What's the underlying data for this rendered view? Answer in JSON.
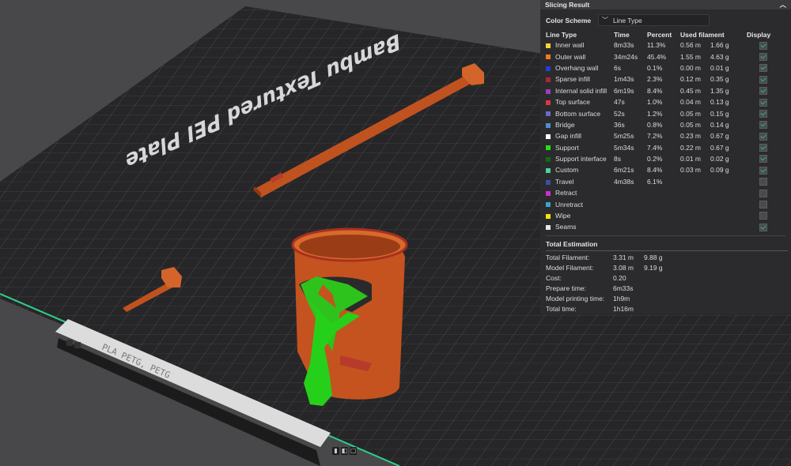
{
  "plate": {
    "name": "Bambu Textured PEI Plate",
    "filament_label": "PLA PETG, PETG"
  },
  "panel": {
    "title": "Slicing Result",
    "collapse_icon": "chevron-up-icon",
    "color_scheme_label": "Color Scheme",
    "color_scheme_value": "Line Type",
    "columns": [
      "Line Type",
      "Time",
      "Percent",
      "Used filament",
      "Display"
    ],
    "rows": [
      {
        "name": "Inner wall",
        "color": "#f5d33a",
        "time": "8m33s",
        "percent": "11.3%",
        "len": "0.56 m",
        "weight": "1.66 g",
        "display": true
      },
      {
        "name": "Outer wall",
        "color": "#f07d24",
        "time": "34m24s",
        "percent": "45.4%",
        "len": "1.55 m",
        "weight": "4.63 g",
        "display": true
      },
      {
        "name": "Overhang wall",
        "color": "#2a3bd8",
        "time": "6s",
        "percent": "0.1%",
        "len": "0.00 m",
        "weight": "0.01 g",
        "display": true
      },
      {
        "name": "Sparse infill",
        "color": "#a82a2a",
        "time": "1m43s",
        "percent": "2.3%",
        "len": "0.12 m",
        "weight": "0.35 g",
        "display": true
      },
      {
        "name": "Internal solid infill",
        "color": "#9a3fb8",
        "time": "6m19s",
        "percent": "8.4%",
        "len": "0.45 m",
        "weight": "1.35 g",
        "display": true
      },
      {
        "name": "Top surface",
        "color": "#e0343c",
        "time": "47s",
        "percent": "1.0%",
        "len": "0.04 m",
        "weight": "0.13 g",
        "display": true
      },
      {
        "name": "Bottom surface",
        "color": "#6a6ac6",
        "time": "52s",
        "percent": "1.2%",
        "len": "0.05 m",
        "weight": "0.15 g",
        "display": true
      },
      {
        "name": "Bridge",
        "color": "#4f8fd0",
        "time": "36s",
        "percent": "0.8%",
        "len": "0.05 m",
        "weight": "0.14 g",
        "display": true
      },
      {
        "name": "Gap infill",
        "color": "#ffffff",
        "time": "5m25s",
        "percent": "7.2%",
        "len": "0.23 m",
        "weight": "0.67 g",
        "display": true
      },
      {
        "name": "Support",
        "color": "#22e01a",
        "time": "5m34s",
        "percent": "7.4%",
        "len": "0.22 m",
        "weight": "0.67 g",
        "display": true
      },
      {
        "name": "Support interface",
        "color": "#0f6b15",
        "time": "8s",
        "percent": "0.2%",
        "len": "0.01 m",
        "weight": "0.02 g",
        "display": true
      },
      {
        "name": "Custom",
        "color": "#4bd19a",
        "time": "6m21s",
        "percent": "8.4%",
        "len": "0.03 m",
        "weight": "0.09 g",
        "display": true
      },
      {
        "name": "Travel",
        "color": "#3a4fa8",
        "time": "4m38s",
        "percent": "6.1%",
        "len": "",
        "weight": "",
        "display": false
      },
      {
        "name": "Retract",
        "color": "#d22ec9",
        "time": "",
        "percent": "",
        "len": "",
        "weight": "",
        "display": false
      },
      {
        "name": "Unretract",
        "color": "#3ba5c9",
        "time": "",
        "percent": "",
        "len": "",
        "weight": "",
        "display": false
      },
      {
        "name": "Wipe",
        "color": "#f2e30f",
        "time": "",
        "percent": "",
        "len": "",
        "weight": "",
        "display": false
      },
      {
        "name": "Seams",
        "color": "#e6e6e6",
        "time": "",
        "percent": "",
        "len": "",
        "weight": "",
        "display": true
      }
    ],
    "total": {
      "title": "Total Estimation",
      "rows": [
        {
          "k": "Total Filament:",
          "v1": "3.31 m",
          "v2": "9.88 g"
        },
        {
          "k": "Model Filament:",
          "v1": "3.08 m",
          "v2": "9.19 g"
        },
        {
          "k": "Cost:",
          "v1": "0.20",
          "v2": ""
        },
        {
          "k": "Prepare time:",
          "v1": "6m33s",
          "v2": ""
        },
        {
          "k": "Model printing time:",
          "v1": "1h9m",
          "v2": ""
        },
        {
          "k": "Total time:",
          "v1": "1h16m",
          "v2": ""
        }
      ]
    }
  }
}
